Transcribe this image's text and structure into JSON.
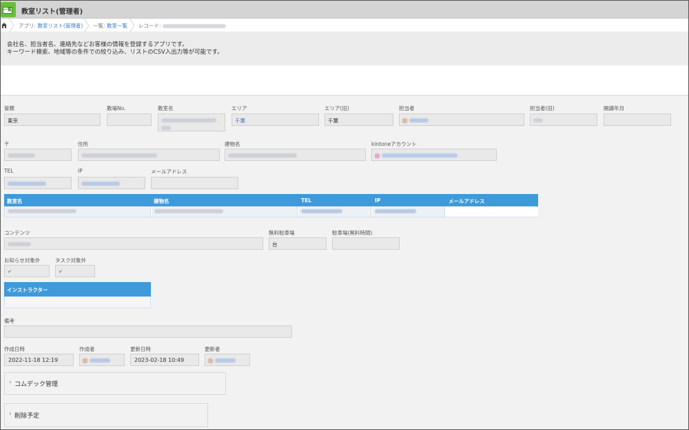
{
  "header": {
    "app_icon_text": "一覧",
    "title": "教室リスト(管理者)"
  },
  "breadcrumb": {
    "app_prefix": "アプリ: ",
    "app_link": "教室リスト(管理者)",
    "view_prefix": "一覧: ",
    "view_link": "教室一覧",
    "record_prefix": "レコード: "
  },
  "description": {
    "line1": "会社名、担当者名、連絡先などお客様の情報を登録するアプリです。",
    "line2": "キーワード検索、地域等の条件での絞り込み、リストのCSV入出力等が可能です。"
  },
  "fields": {
    "kankatsu": {
      "label": "管轄",
      "value": "東京"
    },
    "kyoshitsu_no": {
      "label": "教場No.",
      "value": ""
    },
    "kyoshitsu_mei": {
      "label": "教室名"
    },
    "area": {
      "label": "エリア",
      "value": "千葉"
    },
    "area_old": {
      "label": "エリア(旧)",
      "value": "千葉"
    },
    "tantousha": {
      "label": "担当者"
    },
    "tantousha_old": {
      "label": "担当者(旧)"
    },
    "kaisetsu": {
      "label": "開講年月",
      "value": ""
    },
    "zip": {
      "label": "〒"
    },
    "address": {
      "label": "住所"
    },
    "building": {
      "label": "建物名"
    },
    "kintone": {
      "label": "kintoneアカウント"
    },
    "tel": {
      "label": "TEL"
    },
    "ip": {
      "label": "IP"
    },
    "mail": {
      "label": "メールアドレス",
      "value": ""
    },
    "contents": {
      "label": "コンテンツ"
    },
    "parking_free": {
      "label": "無料駐車場",
      "value": "台"
    },
    "parking_time": {
      "label": "駐車場(無料時間)",
      "value": ""
    },
    "notice_exclude": {
      "label": "お知らせ対象外",
      "value": "✔"
    },
    "task_exclude": {
      "label": "タスク対象外",
      "value": "✔"
    },
    "biko": {
      "label": "備考",
      "value": ""
    },
    "created_at": {
      "label": "作成日時",
      "value": "2022-11-18 12:19"
    },
    "creator": {
      "label": "作成者"
    },
    "updated_at": {
      "label": "更新日時",
      "value": "2023-02-18 10:49"
    },
    "updater": {
      "label": "更新者"
    }
  },
  "table1": {
    "headers": [
      "教室名",
      "建物名",
      "TEL",
      "IP",
      "メールアドレス"
    ]
  },
  "table2": {
    "headers": [
      "インストラクター"
    ]
  },
  "groups": [
    {
      "label": "コムデック管理"
    },
    {
      "label": "削除予定"
    }
  ],
  "colors": {
    "table_header": "#3e9ad9",
    "link": "#3b7cc4",
    "app_icon": "#6abf3a"
  }
}
